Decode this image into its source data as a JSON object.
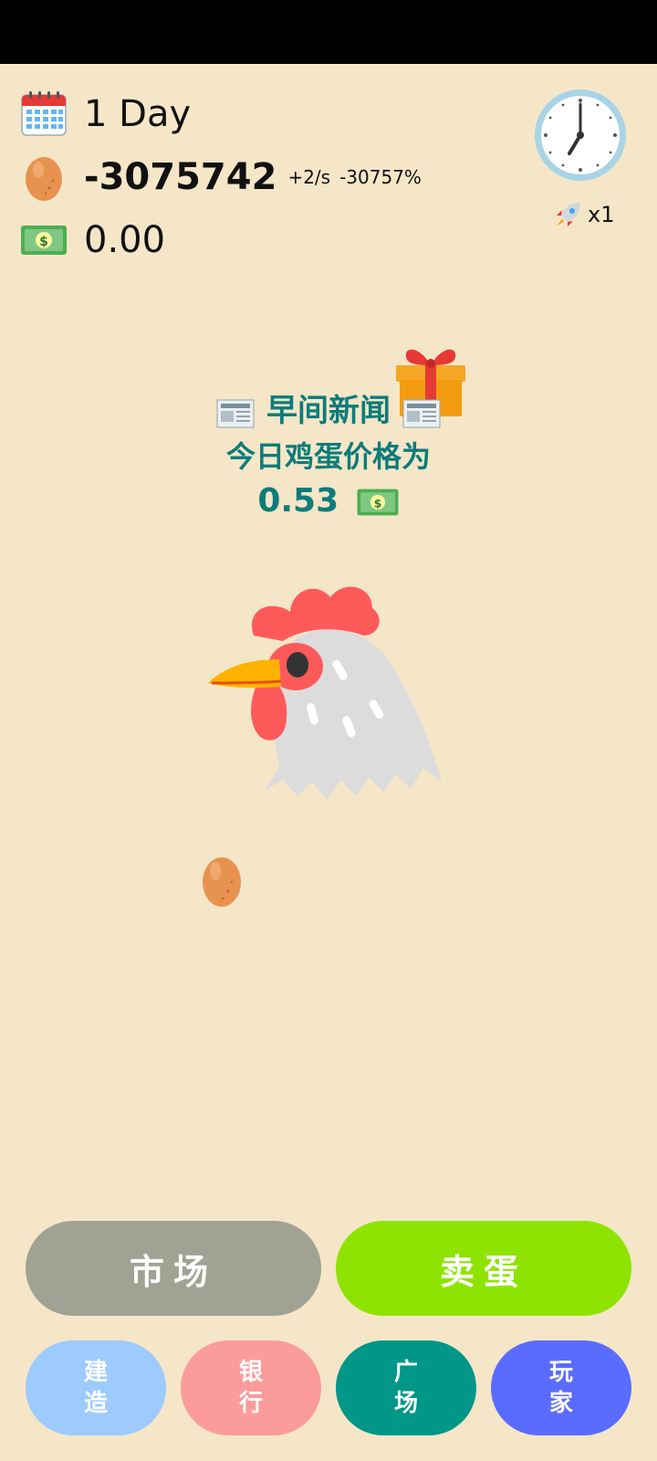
{
  "stats": {
    "day": "1 Day",
    "eggs": "-3075742",
    "egg_rate": "+2/s",
    "egg_percent": "-30757%",
    "money": "0.00"
  },
  "speed": {
    "multiplier": "x1"
  },
  "news": {
    "title": "早间新闻",
    "line": "今日鸡蛋价格为",
    "price": "0.53"
  },
  "buttons": {
    "market": "市场",
    "sell": "卖蛋",
    "build": [
      "建",
      "造"
    ],
    "bank": [
      "银",
      "行"
    ],
    "plaza": [
      "广",
      "场"
    ],
    "players": [
      "玩",
      "家"
    ]
  },
  "colors": {
    "background": "#f5e6c8",
    "news_text": "#0c7c7a",
    "market": "#a0a294",
    "sell": "#8ee400",
    "build": "#9dcaff",
    "bank": "#fc9b9b",
    "plaza": "#009688",
    "players": "#5a6cff"
  },
  "icons": [
    "calendar-icon",
    "egg-icon",
    "money-icon",
    "clock-icon",
    "rocket-icon",
    "newspaper-icon",
    "gift-icon",
    "rooster-icon"
  ]
}
